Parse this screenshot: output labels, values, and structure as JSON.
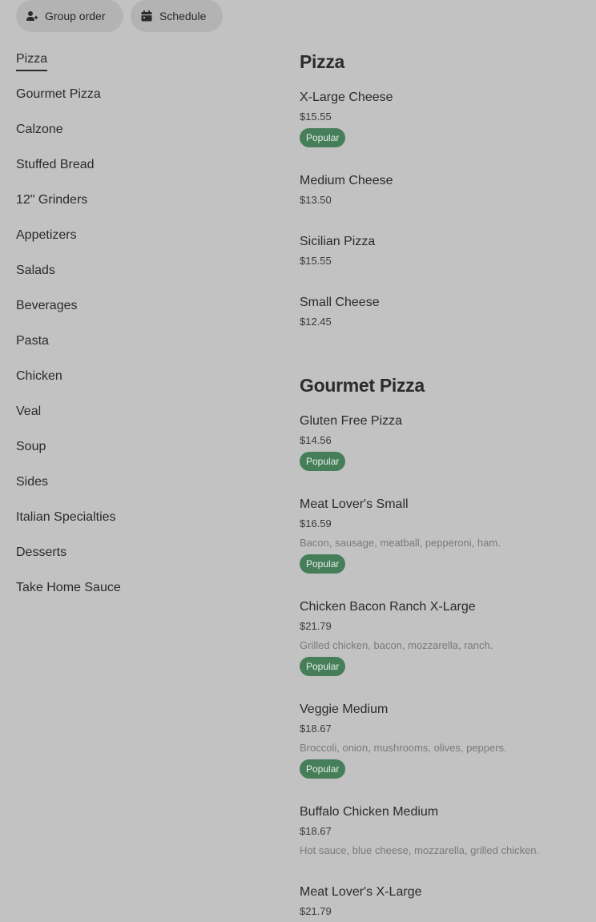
{
  "toolbar": {
    "group_order_label": "Group order",
    "group_order_icon": "person-add-icon",
    "schedule_label": "Schedule",
    "schedule_icon": "calendar-icon"
  },
  "sidebar": {
    "active": "Pizza",
    "items": [
      {
        "label": "Pizza"
      },
      {
        "label": "Gourmet Pizza"
      },
      {
        "label": "Calzone"
      },
      {
        "label": "Stuffed Bread"
      },
      {
        "label": "12\" Grinders"
      },
      {
        "label": "Appetizers"
      },
      {
        "label": "Salads"
      },
      {
        "label": "Beverages"
      },
      {
        "label": "Pasta"
      },
      {
        "label": "Chicken"
      },
      {
        "label": "Veal"
      },
      {
        "label": "Soup"
      },
      {
        "label": "Sides"
      },
      {
        "label": "Italian Specialties"
      },
      {
        "label": "Desserts"
      },
      {
        "label": "Take Home Sauce"
      }
    ]
  },
  "sections": [
    {
      "title": "Pizza",
      "items": [
        {
          "name": "X-Large Cheese",
          "price": "$15.55",
          "badge": "Popular"
        },
        {
          "name": "Medium Cheese",
          "price": "$13.50"
        },
        {
          "name": "Sicilian Pizza",
          "price": "$15.55"
        },
        {
          "name": "Small Cheese",
          "price": "$12.45"
        }
      ]
    },
    {
      "title": "Gourmet Pizza",
      "items": [
        {
          "name": "Gluten Free Pizza",
          "price": "$14.56",
          "badge": "Popular"
        },
        {
          "name": "Meat Lover's Small",
          "price": "$16.59",
          "desc": "Bacon, sausage, meatball, pepperoni, ham.",
          "badge": "Popular"
        },
        {
          "name": "Chicken Bacon Ranch X-Large",
          "price": "$21.79",
          "desc": "Grilled chicken, bacon, mozzarella, ranch.",
          "badge": "Popular"
        },
        {
          "name": "Veggie Medium",
          "price": "$18.67",
          "desc": "Broccoli, onion, mushrooms, olives, peppers.",
          "badge": "Popular"
        },
        {
          "name": "Buffalo Chicken Medium",
          "price": "$18.67",
          "desc": "Hot sauce, blue cheese, mozzarella, grilled chicken."
        },
        {
          "name": "Meat Lover's X-Large",
          "price": "$21.79"
        }
      ]
    }
  ],
  "colors": {
    "background": "#c2c2c2",
    "popular_badge": "#467e5a",
    "pill_button": "#b3b3b3"
  }
}
